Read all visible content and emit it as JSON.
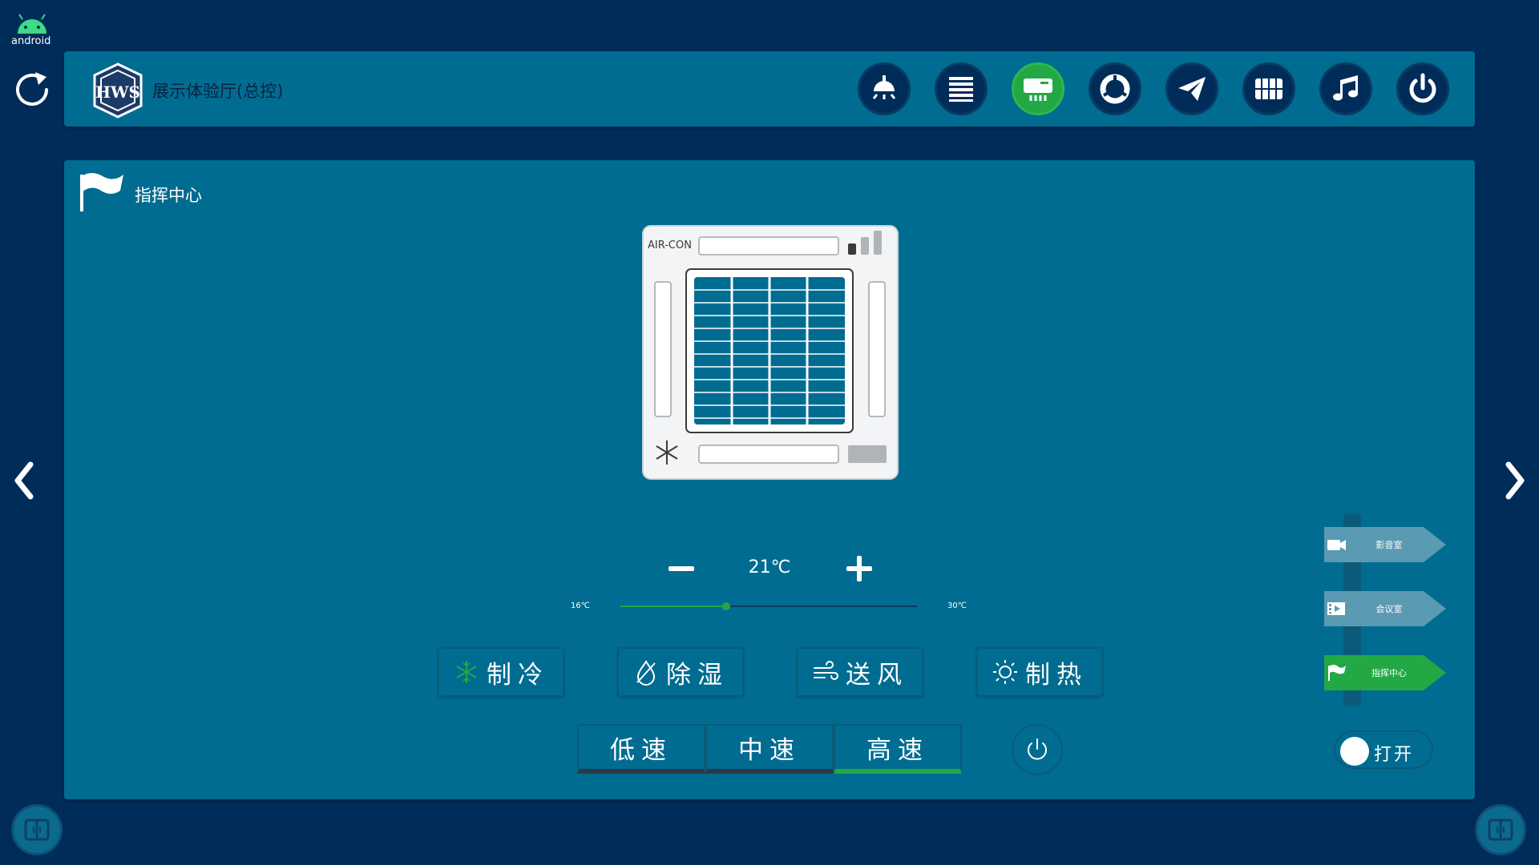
{
  "system": {
    "os_label": "android"
  },
  "header": {
    "title": "展示体验厅(总控)",
    "nav_icons": [
      "lamp-icon",
      "curtain-icon",
      "air-conditioner-icon",
      "scene-icon",
      "plane-icon",
      "grid-icon",
      "music-icon",
      "power-icon"
    ],
    "active_icon": "air-conditioner-icon"
  },
  "room": {
    "name": "指挥中心"
  },
  "ac": {
    "device_label": "AIR-CON",
    "temperature": "21℃",
    "temp_min": "16℃",
    "temp_max": "30℃",
    "slider_value": 21,
    "slider_min": 16,
    "slider_max": 30,
    "modes": [
      {
        "label": "制冷",
        "icon": "snowflake-icon"
      },
      {
        "label": "除湿",
        "icon": "droplet-icon"
      },
      {
        "label": "送风",
        "icon": "wind-icon"
      },
      {
        "label": "制热",
        "icon": "sun-icon"
      }
    ],
    "speeds": [
      {
        "label": "低速",
        "active": false
      },
      {
        "label": "中速",
        "active": false
      },
      {
        "label": "高速",
        "active": true
      }
    ]
  },
  "room_tabs": [
    {
      "label": "影音室",
      "icon": "video-camera-icon",
      "active": false
    },
    {
      "label": "会议室",
      "icon": "film-icon",
      "active": false
    },
    {
      "label": "指挥中心",
      "icon": "flag-icon",
      "active": true
    }
  ],
  "toggle": {
    "label": "打开",
    "state": "on"
  },
  "colors": {
    "background": "#002c5a",
    "panel": "#006c91",
    "active_green": "#22a845"
  }
}
